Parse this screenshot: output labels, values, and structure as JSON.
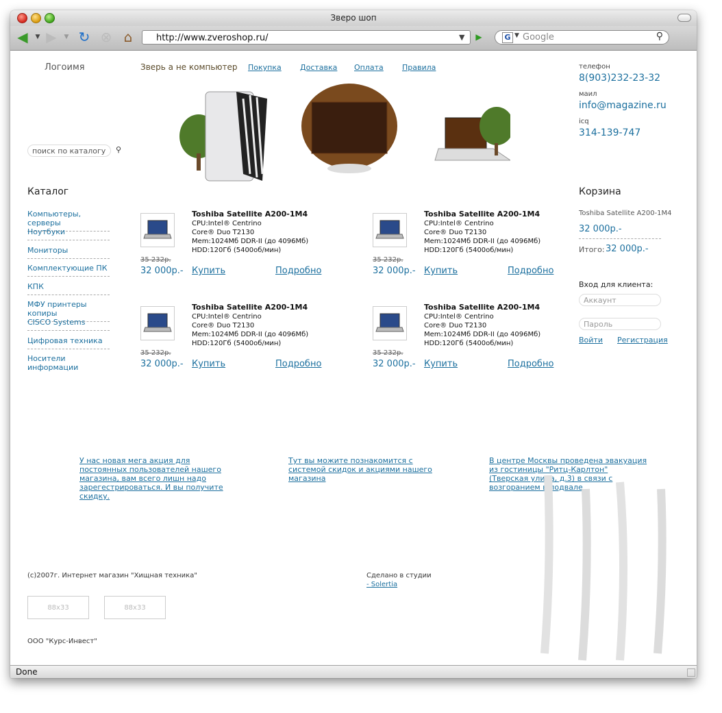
{
  "window": {
    "title": "Зверо шоп"
  },
  "toolbar": {
    "url": "http://www.zveroshop.ru/",
    "search_placeholder": "Google"
  },
  "status": {
    "text": "Done"
  },
  "header": {
    "logo": "Логоимя",
    "slogan": "Зверь а не компьютер",
    "nav": [
      "Покупка",
      "Доставка",
      "Оплата",
      "Правила"
    ]
  },
  "contacts": {
    "phone_label": "телефон",
    "phone": "8(903)232-23-32",
    "mail_label": "маил",
    "mail": "info@magazine.ru",
    "icq_label": "icq",
    "icq": "314-139-747"
  },
  "search": {
    "placeholder": "поиск по каталогу"
  },
  "catalog": {
    "title": "Каталог",
    "items": [
      "Компьютеры, серверы",
      "Ноутбуки",
      "Мониторы",
      "Комплектующие ПК",
      "КПК",
      "МФУ принтеры копиры",
      "CISCO Systems",
      "Цифровая техника",
      "Носители информации"
    ]
  },
  "products": [
    {
      "title": "Toshiba Satellite A200-1M4",
      "spec1": "CPU:Intel® Centrino",
      "spec2": "Core® Duo T2130",
      "spec3": "Mem:1024Мб DDR-II (до 4096Мб)",
      "spec4": "HDD:120Гб (5400об/мин)",
      "old_price": "35 232р.",
      "price": "32 000р.-",
      "buy": "Купить",
      "more": "Подробно"
    },
    {
      "title": "Toshiba Satellite A200-1M4",
      "spec1": "CPU:Intel® Centrino",
      "spec2": "Core® Duo T2130",
      "spec3": "Mem:1024Мб DDR-II (до 4096Мб)",
      "spec4": "HDD:120Гб (5400об/мин)",
      "old_price": "35 232р.",
      "price": "32 000р.-",
      "buy": "Купить",
      "more": "Подробно"
    },
    {
      "title": "Toshiba Satellite A200-1M4",
      "spec1": "CPU:Intel® Centrino",
      "spec2": "Core® Duo T2130",
      "spec3": "Mem:1024Мб DDR-II (до 4096Мб)",
      "spec4": "HDD:120Гб (5400об/мин)",
      "old_price": "35 232р.",
      "price": "32 000р.-",
      "buy": "Купить",
      "more": "Подробно"
    },
    {
      "title": "Toshiba Satellite A200-1M4",
      "spec1": "CPU:Intel® Centrino",
      "spec2": "Core® Duo T2130",
      "spec3": "Mem:1024Мб DDR-II (до 4096Мб)",
      "spec4": "HDD:120Гб (5400об/мин)",
      "old_price": "35 232р.",
      "price": "32 000р.-",
      "buy": "Купить",
      "more": "Подробно"
    }
  ],
  "cart": {
    "title": "Корзина",
    "item_name": "Toshiba Satellite A200-1M4",
    "item_price": "32 000р.-",
    "total_label": "Итого:",
    "total": "32 000р.-"
  },
  "login": {
    "title": "Вход для клиента:",
    "account_placeholder": "Аккаунт",
    "password_placeholder": "Пароль",
    "login": "Войти",
    "register": "Регистрация"
  },
  "news": [
    {
      "l1": "У нас новая мега акция для",
      "l2": "постоянных пользователей нашего",
      "l3": "магазина, вам всего лишн надо",
      "l4": "зарегестрироваться. И вы получите",
      "l5": "скидку."
    },
    {
      "l1": "Тут вы можите познакомится с",
      "l2": "системой скидок и акциями нашего",
      "l3": "магазина"
    },
    {
      "l1": "В центре Москвы проведена эвакуация",
      "l2": "из гостиницы \"Ритц-Карлтон\"",
      "l3": "(Тверская улица, д.3) в связи с",
      "l4": "возгоранием в подвале"
    }
  ],
  "footer": {
    "copyright": "(с)2007г. Интернет магазин \"Хищная техника\"",
    "studio_label": "Сделано в студии",
    "studio_link": "- Solertia",
    "badge1": "88x33",
    "badge2": "88x33",
    "company": "ООО \"Курс-Инвест\""
  }
}
